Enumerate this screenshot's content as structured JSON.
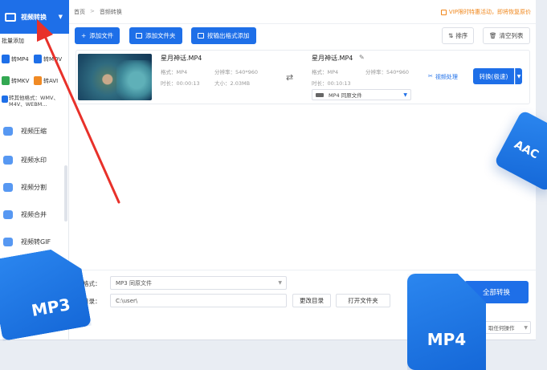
{
  "sidebar": {
    "active_label": "视频转换",
    "batch_label": "批量添加",
    "formats": [
      {
        "label": "转MP4"
      },
      {
        "label": "转MOV"
      },
      {
        "label": "转MKV"
      },
      {
        "label": "转AVI"
      }
    ],
    "other_formats": "转其他格式：WMV、M4V、WEBM...",
    "items": [
      {
        "label": "视频压缩",
        "icon": "compress-icon"
      },
      {
        "label": "视频水印",
        "icon": "watermark-icon"
      },
      {
        "label": "视频分割",
        "icon": "split-icon"
      },
      {
        "label": "视频合并",
        "icon": "merge-icon"
      },
      {
        "label": "视频转GIF",
        "icon": "gif-icon"
      }
    ]
  },
  "topbar": {
    "breadcrumb": [
      "首页",
      "音频转换"
    ],
    "vip_text": "VIP限时特惠活动，即将恢复原价"
  },
  "toolbar": {
    "add_file": "添加文件",
    "add_folder": "添加文件夹",
    "add_by_format": "按输出格式添加",
    "sort": "排序",
    "clear_list": "清空列表"
  },
  "file": {
    "src_name": "星月神话.MP4",
    "src_format_label": "格式：",
    "src_format": "MP4",
    "src_res_label": "分辨率：",
    "src_res": "540*960",
    "src_dur_label": "时长：",
    "src_dur": "00:00:13",
    "src_size_label": "大小：",
    "src_size": "2.03MB",
    "out_name": "星月神话.MP4",
    "out_format_label": "格式：",
    "out_format": "MP4",
    "out_res_label": "分辨率：",
    "out_res": "540*960",
    "out_dur_label": "时长：",
    "out_dur": "00:10:13",
    "out_select": "MP4 同原文件",
    "video_process": "视频处理",
    "convert_button": "转换(极速)"
  },
  "bottom": {
    "out_format_label": "输出格式：",
    "out_format_value": "MP3 同原文件",
    "out_dir_label": "输出目录：",
    "out_dir_value": "C:\\user\\",
    "change_dir": "更改目录",
    "open_folder": "打开文件夹",
    "convert_all": "全部转换",
    "after_op": "取任何操作"
  },
  "decor": {
    "mp3": "MP3",
    "mp4": "MP4",
    "aac": "AAC"
  },
  "colors": {
    "accent": "#1e6fe8",
    "vip": "#f0871c",
    "arrow": "#e8312a"
  }
}
